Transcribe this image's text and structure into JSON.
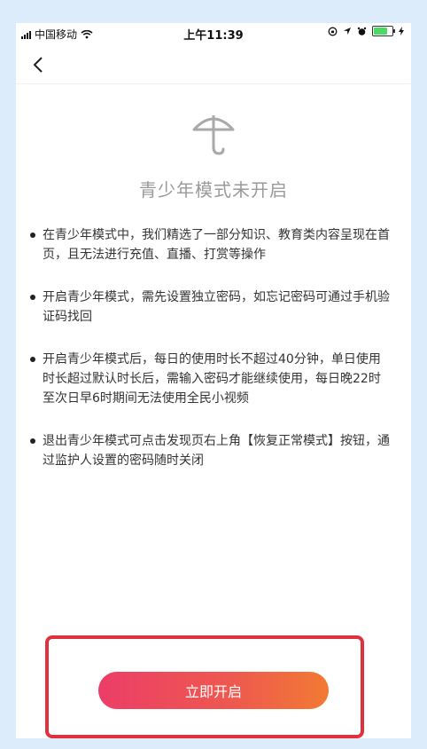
{
  "status": {
    "carrier": "中国移动",
    "time": "上午11:39"
  },
  "page": {
    "title": "青少年模式未开启",
    "rules": [
      "在青少年模式中，我们精选了一部分知识、教育类内容呈现在首页，且无法进行充值、直播、打赏等操作",
      "开启青少年模式，需先设置独立密码，如忘记密码可通过手机验证码找回",
      "开启青少年模式后，每日的使用时长不超过40分钟，单日使用时长超过默认时长后，需输入密码才能继续使用，每日晚22时至次日早6时期间无法使用全民小视频",
      "退出青少年模式可点击发现页右上角【恢复正常模式】按钮，通过监护人设置的密码随时关闭"
    ],
    "button_label": "立即开启"
  },
  "colors": {
    "button_gradient_start": "#ec3d67",
    "button_gradient_end": "#f27a33",
    "highlight_frame": "#e0323e",
    "title_gray": "#9a9a9a"
  }
}
